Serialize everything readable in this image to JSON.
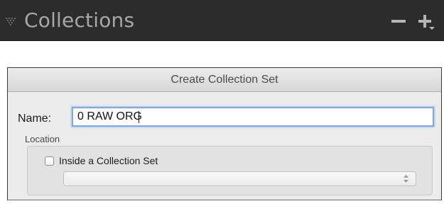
{
  "panel": {
    "title": "Collections",
    "minus_icon": "minus-icon",
    "plus_icon": "plus-dropdown-icon",
    "disclosure_icon": "disclosure-triangle-icon"
  },
  "dialog": {
    "title": "Create Collection Set",
    "name_label": "Name:",
    "name_value": "0 RAW ORG",
    "location_label": "Location",
    "inside_checkbox_label": "Inside a Collection Set",
    "inside_checkbox_checked": false,
    "collection_set_select_value": ""
  },
  "colors": {
    "panel_bg": "#2c2c2c",
    "panel_text": "#a7a7a7",
    "focus_ring": "#7ea9e3",
    "dialog_bg": "#ececec"
  }
}
